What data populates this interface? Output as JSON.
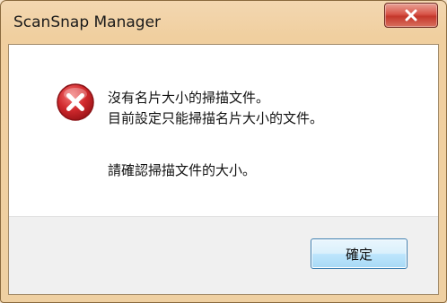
{
  "window": {
    "title": "ScanSnap Manager",
    "close_icon": "close-x-icon"
  },
  "dialog": {
    "icon": "error-icon",
    "message_line1": "沒有名片大小的掃描文件。",
    "message_line2": "目前設定只能掃描名片大小的文件。",
    "message_line3": "請確認掃描文件的大小。"
  },
  "buttons": {
    "ok_label": "確定"
  },
  "colors": {
    "frame": "#f0cf9f",
    "close_button": "#c4372b",
    "error_icon": "#c8242a",
    "ok_button_border": "#3c7fb1"
  }
}
